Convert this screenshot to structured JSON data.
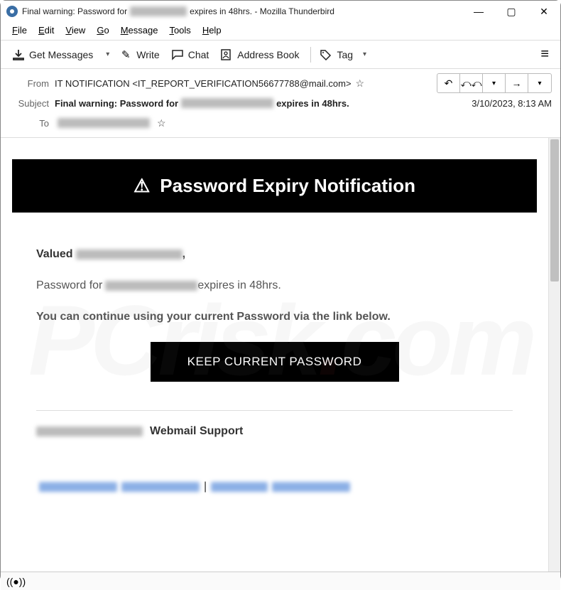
{
  "window": {
    "title_prefix": "Final warning: Password for",
    "title_suffix": "expires in 48hrs. - Mozilla Thunderbird",
    "minimize": "—",
    "maximize": "▢",
    "close": "✕"
  },
  "menubar": {
    "file": "File",
    "edit": "Edit",
    "view": "View",
    "go": "Go",
    "message": "Message",
    "tools": "Tools",
    "help": "Help"
  },
  "toolbar": {
    "get_messages": "Get Messages",
    "write": "Write",
    "chat": "Chat",
    "address_book": "Address Book",
    "tag": "Tag"
  },
  "headers": {
    "from_label": "From",
    "from_name": "IT NOTIFICATION",
    "from_email": "<IT_REPORT_VERIFICATION56677788@mail.com>",
    "subject_label": "Subject",
    "subject_prefix": "Final warning: Password for",
    "subject_suffix": "expires in 48hrs.",
    "to_label": "To",
    "date": "3/10/2023, 8:13 AM"
  },
  "email": {
    "banner_title": "Password Expiry Notification",
    "valued": "Valued",
    "password_for": "Password for",
    "expires_in": "expires in 48hrs.",
    "continue_text": "You can continue using your current Password via the link below.",
    "cta": "KEEP CURRENT PASSWORD",
    "support": "Webmail Support",
    "separator": "|"
  },
  "watermark": {
    "p1": "PC",
    "p2": "risk",
    "dot": ".",
    "p3": "com"
  }
}
